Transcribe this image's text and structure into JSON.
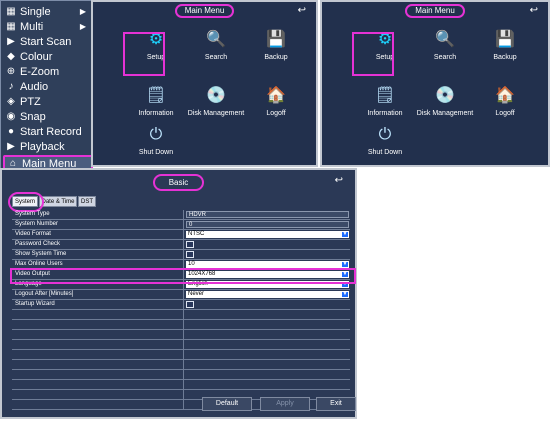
{
  "context_menu": {
    "items": [
      {
        "label": "Single",
        "icon": "single-view-icon",
        "arrow": "▶"
      },
      {
        "label": "Multi",
        "icon": "multi-view-icon",
        "arrow": "▶"
      },
      {
        "label": "Start Scan",
        "icon": "scan-icon"
      },
      {
        "label": "Colour",
        "icon": "colour-icon"
      },
      {
        "label": "E-Zoom",
        "icon": "zoom-icon"
      },
      {
        "label": "Audio",
        "icon": "audio-icon"
      },
      {
        "label": "PTZ",
        "icon": "ptz-icon"
      },
      {
        "label": "Snap",
        "icon": "snap-icon"
      },
      {
        "label": "Start Record",
        "icon": "record-icon"
      },
      {
        "label": "Playback",
        "icon": "playback-icon"
      },
      {
        "label": "Main Menu",
        "icon": "main-menu-icon"
      }
    ]
  },
  "main_menu": {
    "title": "Main Menu",
    "back_icon": "↩",
    "tiles": [
      {
        "label": "Setup",
        "icon": "setup-gear-icon",
        "glyph": "⚙"
      },
      {
        "label": "Search",
        "icon": "search-icon",
        "glyph": "🔍"
      },
      {
        "label": "Backup",
        "icon": "backup-icon",
        "glyph": "💾"
      },
      {
        "label": "Information",
        "icon": "information-icon",
        "glyph": "🗒"
      },
      {
        "label": "Disk Management",
        "icon": "disk-management-icon",
        "glyph": "💿"
      },
      {
        "label": "Logoff",
        "icon": "logoff-icon",
        "glyph": "🏠"
      },
      {
        "label": "Shut Down",
        "icon": "shutdown-icon",
        "glyph": "⏻"
      }
    ]
  },
  "basic": {
    "title": "Basic",
    "back_icon": "↩",
    "tabs": [
      "System",
      "Date & Time",
      "DST"
    ],
    "rows": [
      {
        "label": "System Type",
        "type": "text",
        "value": "HDVR"
      },
      {
        "label": "System Number",
        "type": "text",
        "value": "0"
      },
      {
        "label": "Video Format",
        "type": "select",
        "value": "NTSC"
      },
      {
        "label": "Password Check",
        "type": "checkbox",
        "value": ""
      },
      {
        "label": "Show System Time",
        "type": "checkbox",
        "value": ""
      },
      {
        "label": "Max Online Users",
        "type": "select",
        "value": "10"
      },
      {
        "label": "Video Output",
        "type": "select",
        "value": "1024X768"
      },
      {
        "label": "Language",
        "type": "select",
        "value": "English"
      },
      {
        "label": "Logout After [Minutes]",
        "type": "select",
        "value": "Never"
      },
      {
        "label": "Startup Wizard",
        "type": "checkbox",
        "value": ""
      }
    ],
    "buttons": {
      "default": "Default",
      "apply": "Apply",
      "exit": "Exit"
    }
  },
  "colors": {
    "panel": "#22304d",
    "highlight": "#e532d5",
    "dropdown": "#1d6cff"
  }
}
